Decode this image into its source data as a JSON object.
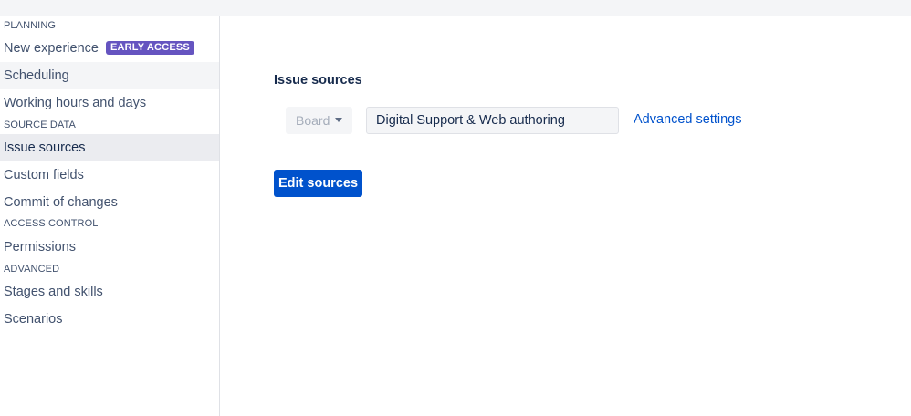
{
  "sidebar": {
    "planning_heading": "PLANNING",
    "new_experience": {
      "label": "New experience",
      "badge": "EARLY ACCESS",
      "badge_color": "#6554c0"
    },
    "scheduling": "Scheduling",
    "working_hours": "Working hours and days",
    "source_data_heading": "SOURCE DATA",
    "issue_sources": "Issue sources",
    "custom_fields": "Custom fields",
    "commit_changes": "Commit of changes",
    "access_control_heading": "ACCESS CONTROL",
    "permissions": "Permissions",
    "advanced_heading": "ADVANCED",
    "stages_skills": "Stages and skills",
    "scenarios": "Scenarios"
  },
  "main": {
    "title": "Issue sources",
    "board_select": {
      "value": "Board"
    },
    "source_field": {
      "value": "Digital Support & Web authoring"
    },
    "advanced_settings": "Advanced settings",
    "edit_button": "Edit sources",
    "accent_color": "#0052cc"
  }
}
